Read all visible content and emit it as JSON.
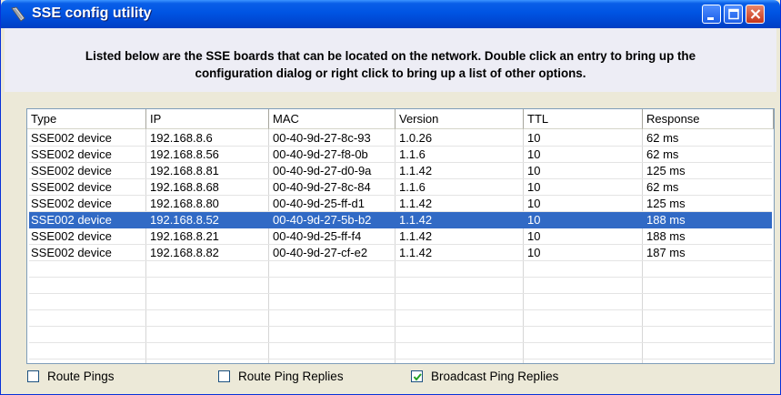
{
  "window": {
    "title": "SSE config utility",
    "colors": {
      "titlebar": "#0054e3",
      "selection": "#316ac5",
      "face": "#ece9d8"
    },
    "controls": [
      "minimize-icon",
      "maximize-icon",
      "close-icon"
    ]
  },
  "header": {
    "line1": "Listed below are the SSE boards that can be located on the network. Double click an entry to bring up the",
    "line2": "configuration dialog or right click to bring up a list of other options."
  },
  "table": {
    "columns": [
      "Type",
      "IP",
      "MAC",
      "Version",
      "TTL",
      "Response"
    ],
    "rows": [
      [
        "SSE002 device",
        "192.168.8.6",
        "00-40-9d-27-8c-93",
        "1.0.26",
        "10",
        "62 ms"
      ],
      [
        "SSE002 device",
        "192.168.8.56",
        "00-40-9d-27-f8-0b",
        "1.1.6",
        "10",
        "62 ms"
      ],
      [
        "SSE002 device",
        "192.168.8.81",
        "00-40-9d-27-d0-9a",
        "1.1.42",
        "10",
        "125 ms"
      ],
      [
        "SSE002 device",
        "192.168.8.68",
        "00-40-9d-27-8c-84",
        "1.1.6",
        "10",
        "62 ms"
      ],
      [
        "SSE002 device",
        "192.168.8.80",
        "00-40-9d-25-ff-d1",
        "1.1.42",
        "10",
        "125 ms"
      ],
      [
        "SSE002 device",
        "192.168.8.52",
        "00-40-9d-27-5b-b2",
        "1.1.42",
        "10",
        "188 ms"
      ],
      [
        "SSE002 device",
        "192.168.8.21",
        "00-40-9d-25-ff-f4",
        "1.1.42",
        "10",
        "188 ms"
      ],
      [
        "SSE002 device",
        "192.168.8.82",
        "00-40-9d-27-cf-e2",
        "1.1.42",
        "10",
        "187 ms"
      ]
    ],
    "selected_row": 5
  },
  "options": {
    "route_pings": {
      "label": "Route Pings",
      "checked": false
    },
    "route_ping_replies": {
      "label": "Route Ping Replies",
      "checked": false
    },
    "broadcast_ping_replies": {
      "label": "Broadcast Ping Replies",
      "checked": true
    }
  }
}
